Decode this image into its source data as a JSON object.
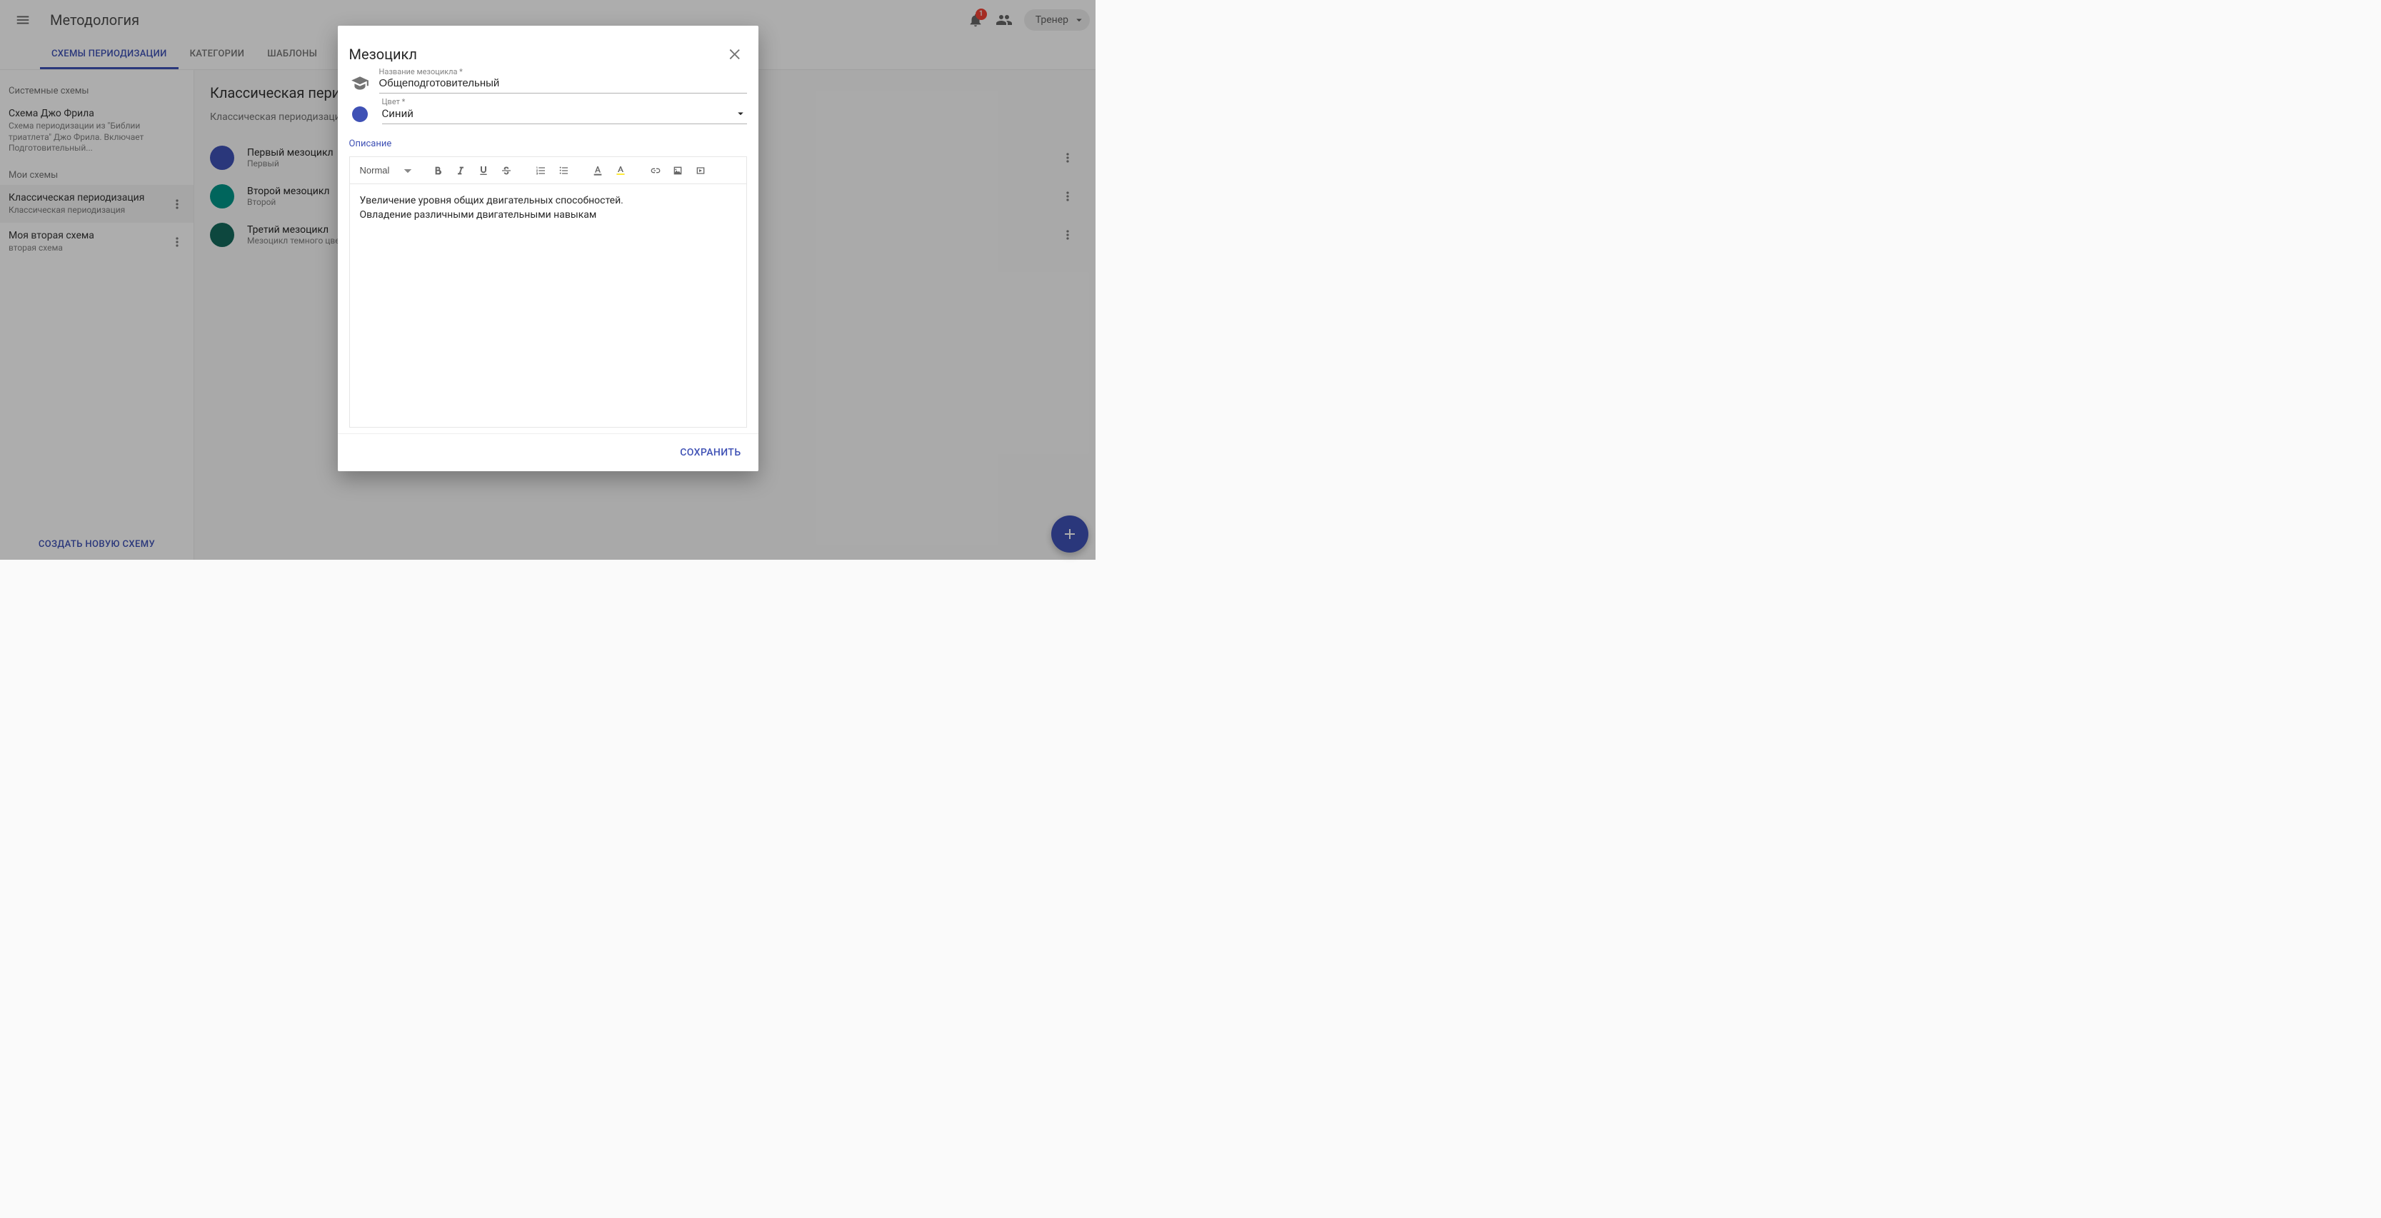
{
  "appbar": {
    "title": "Методология",
    "notification_count": "1",
    "role_chip": "Тренер"
  },
  "tabs": [
    {
      "label": "СХЕМЫ ПЕРИОДИЗАЦИИ",
      "active": true
    },
    {
      "label": "КАТЕГОРИИ"
    },
    {
      "label": "ШАБЛОНЫ"
    }
  ],
  "sidebar": {
    "system_label": "Системные схемы",
    "my_label": "Мои схемы",
    "system_schemes": [
      {
        "name": "Схема Джо Фрила",
        "desc": "Схема периодизации из \"Библии триатлета\" Джо Фрила. Включает Подготовительный..."
      }
    ],
    "my_schemes": [
      {
        "name": "Классическая периодизация",
        "desc": "Классическая периодизация",
        "active": true
      },
      {
        "name": "Моя вторая схема",
        "desc": "вторая схема"
      }
    ],
    "create_label": "СОЗДАТЬ НОВУЮ СХЕМУ"
  },
  "main": {
    "title": "Классическая периодизация",
    "subtitle": "Классическая периодизация",
    "mesocycles": [
      {
        "name": "Первый мезоцикл",
        "sub": "Первый",
        "color": "#3f51b5"
      },
      {
        "name": "Второй мезоцикл",
        "sub": "Второй",
        "color": "#009688"
      },
      {
        "name": "Третий мезоцикл",
        "sub": "Мезоцикл темного цвета",
        "color": "#14695c"
      }
    ]
  },
  "dialog": {
    "title": "Мезоцикл",
    "name_label": "Название мезоцикла *",
    "name_value": "Общеподготовительный",
    "color_label": "Цвет *",
    "color_value": "Синий",
    "color_swatch": "#3f51b5",
    "description_label": "Описание",
    "format_value": "Normal",
    "body_line1": "Увеличение уровня общих двигательных способностей.",
    "body_line2": "Овладение различными двигательными навыкам",
    "save_label": "СОХРАНИТЬ"
  }
}
